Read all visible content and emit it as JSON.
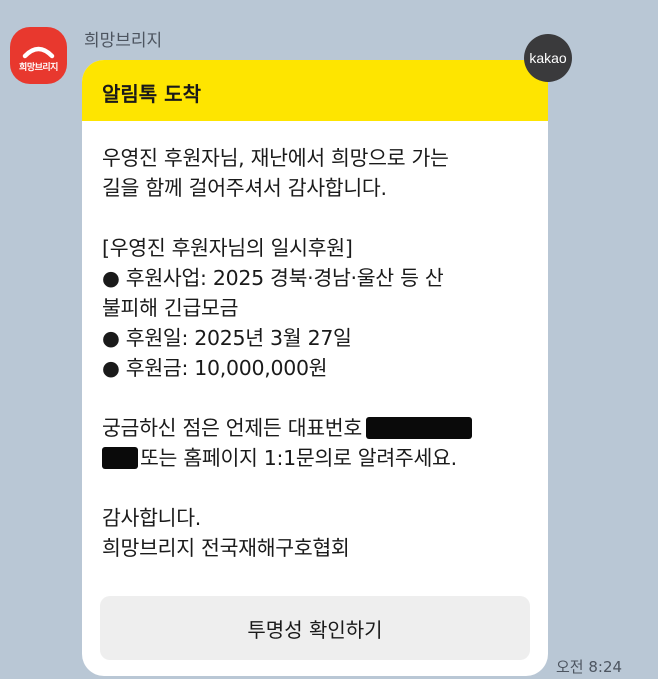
{
  "sender": {
    "avatar_text": "희망브리지",
    "name": "희망브리지"
  },
  "badge": {
    "label": "kakao"
  },
  "message": {
    "header_title": "알림톡 도착",
    "lines": {
      "l1": "우영진 후원자님, 재난에서 희망으로 가는",
      "l2": "길을 함께 걸어주셔서 감사합니다.",
      "l3": "[우영진 후원자님의 일시후원]",
      "l4": "● 후원사업: 2025 경북·경남·울산 등 산",
      "l5": "불피해 긴급모금",
      "l6": "● 후원일: 2025년 3월 27일",
      "l7": "● 후원금: 10,000,000원",
      "l8": "궁금하신 점은 언제든 대표번호",
      "l9": "또는 홈페이지 1:1문의로 알려주세요.",
      "l10": "감사합니다.",
      "l11": "희망브리지 전국재해구호협회"
    },
    "button_label": "투명성 확인하기"
  },
  "timestamp": "오전 8:24",
  "colors": {
    "background": "#b9c7d5",
    "header": "#fee500",
    "avatar": "#e8382e",
    "badge": "#3a3a3c"
  }
}
